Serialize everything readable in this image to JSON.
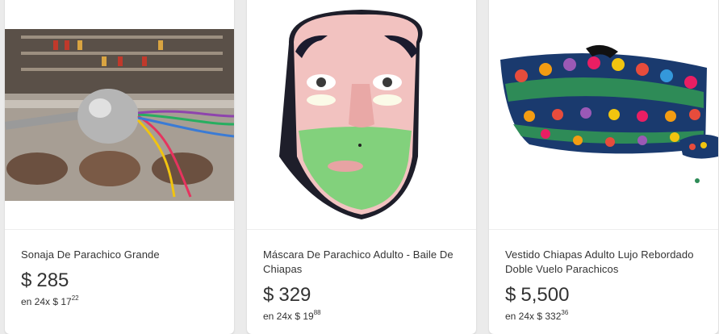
{
  "products": [
    {
      "title": "Sonaja De Parachico Grande",
      "currency": "$",
      "price": "285",
      "installments_prefix": "en 24x",
      "installment_whole": "$ 17",
      "installment_cents": "22",
      "image_icon": "maraca-rattle-photo"
    },
    {
      "title": "Máscara De Parachico Adulto - Baile De Chiapas",
      "currency": "$",
      "price": "329",
      "installments_prefix": "en 24x",
      "installment_whole": "$ 19",
      "installment_cents": "88",
      "image_icon": "carved-mask-photo"
    },
    {
      "title": "Vestido Chiapas Adulto Lujo Rebordado Doble Vuelo Parachicos",
      "currency": "$",
      "price": "5,500",
      "installments_prefix": "en 24x",
      "installment_whole": "$ 332",
      "installment_cents": "36",
      "image_icon": "embroidered-dress-photo"
    }
  ]
}
